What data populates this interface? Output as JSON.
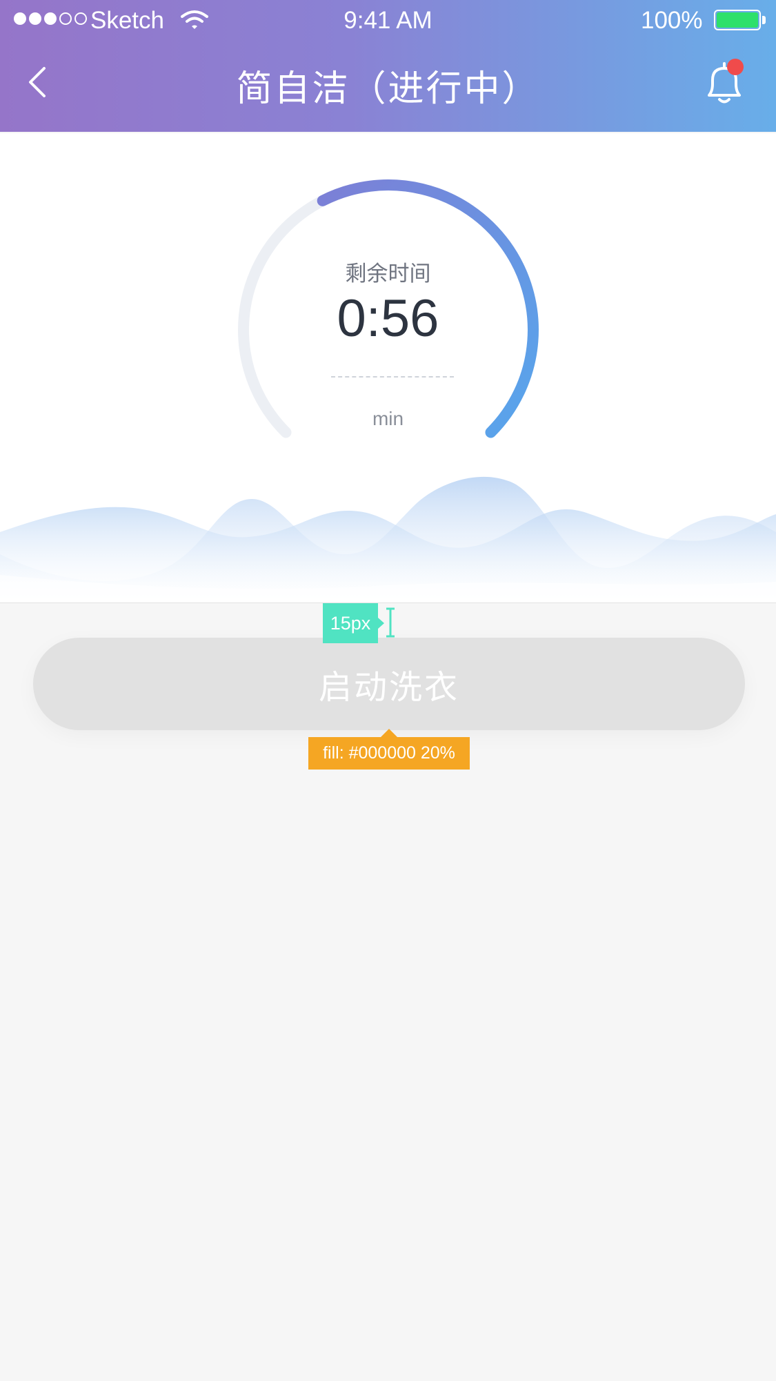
{
  "status_bar": {
    "carrier": "Sketch",
    "time": "9:41 AM",
    "battery": "100%",
    "signal_bars_filled": 3,
    "signal_bars_total": 5
  },
  "nav": {
    "title": "简自洁（进行中）",
    "back_icon": "chevron-left-icon",
    "bell_icon": "bell-icon",
    "has_notification": true
  },
  "timer": {
    "label": "剩余时间",
    "value": "0:56",
    "unit": "min",
    "progress_fraction": 0.6
  },
  "action": {
    "start_label": "启动洗衣"
  },
  "annotations": {
    "spacing": "15px",
    "fill": "fill: #000000 20%"
  },
  "colors": {
    "header_start": "#9575c9",
    "header_end": "#68aee9",
    "ring_start": "#7c7fd6",
    "ring_end": "#57a6ec",
    "ring_track": "#eceff4",
    "button_bg": "#e1e1e1",
    "notification": "#f04b4b",
    "spacing_tag": "#50e3c2",
    "fill_tag": "#f5a623"
  }
}
